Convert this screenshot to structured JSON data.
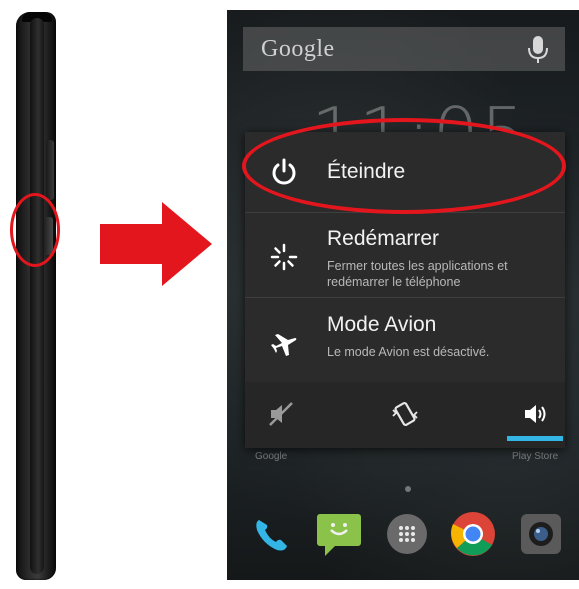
{
  "search": {
    "label": "Google",
    "icon": "mic-icon"
  },
  "clock": {
    "time": "11:05"
  },
  "wallpaper_labels": {
    "left": "Google",
    "right": "Play Store"
  },
  "power_menu": {
    "items": [
      {
        "id": "shutdown",
        "icon": "power-icon",
        "title": "Éteindre",
        "description": ""
      },
      {
        "id": "restart",
        "icon": "restart-icon",
        "title": "Redémarrer",
        "description": "Fermer toutes les applications et redémarrer le téléphone"
      },
      {
        "id": "airplane",
        "icon": "airplane-icon",
        "title": "Mode Avion",
        "description": "Le mode Avion est désactivé."
      }
    ],
    "sound_modes": [
      {
        "id": "silent",
        "icon": "mute-icon",
        "selected": false
      },
      {
        "id": "vibrate",
        "icon": "vibrate-icon",
        "selected": false
      },
      {
        "id": "sound",
        "icon": "volume-icon",
        "selected": true
      }
    ]
  },
  "dock": [
    "phone-icon",
    "messaging-icon",
    "app-drawer-icon",
    "chrome-icon",
    "camera-icon"
  ],
  "colors": {
    "highlight": "#e3161d",
    "accent": "#33b5e5",
    "menu_bg": "#2b2b2b"
  }
}
